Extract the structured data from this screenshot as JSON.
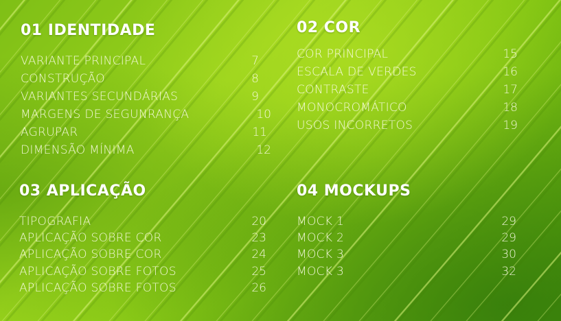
{
  "sections": [
    {
      "title": "01 IDENTIDADE",
      "items": [
        {
          "label": "VARIANTE PRINCIPAL",
          "page": "7"
        },
        {
          "label": "CONSTRUÇÃO",
          "page": "8"
        },
        {
          "label": "VARIANTES SECUNDÁRIAS",
          "page": "9"
        },
        {
          "label": "MARGENS DE SEGUNRANÇA",
          "page": "10"
        },
        {
          "label": "AGRUPAR",
          "page": "11"
        },
        {
          "label": "DIMENSÃO MÍNIMA",
          "page": "12"
        }
      ]
    },
    {
      "title": "02 COR",
      "items": [
        {
          "label": "COR PRINCIPAL",
          "page": "15"
        },
        {
          "label": "ESCALA DE VERDES",
          "page": "16"
        },
        {
          "label": "CONTRASTE",
          "page": "17"
        },
        {
          "label": "MONOCROMÁTICO",
          "page": "18"
        },
        {
          "label": "USOS INCORRETOS",
          "page": "19"
        }
      ]
    },
    {
      "title": "03 APLICAÇÃO",
      "items": [
        {
          "label": "TIPOGRAFIA",
          "page": "20"
        },
        {
          "label": "APLICAÇÃO  SOBRE COR",
          "page": "23"
        },
        {
          "label": "APLICAÇÃO  SOBRE COR",
          "page": "24"
        },
        {
          "label": "APLICAÇÃO   SOBRE FOTOS",
          "page": "25"
        },
        {
          "label": "APLICAÇÃO   SOBRE FOTOS",
          "page": "26"
        }
      ]
    },
    {
      "title": "04 MOCKUPS",
      "items": [
        {
          "label": "MOCK 1",
          "page": "29"
        },
        {
          "label": "MOCK 2",
          "page": "29"
        },
        {
          "label": "MOCK 3",
          "page": "30"
        },
        {
          "label": "MOCK 3",
          "page": "32"
        }
      ]
    }
  ],
  "background": {
    "subject": "green-leaf-texture",
    "colors": {
      "light": "#9ad41e",
      "mid": "#7fbf16",
      "dark": "#4f9a0c",
      "vein": "#d9f27a"
    }
  }
}
